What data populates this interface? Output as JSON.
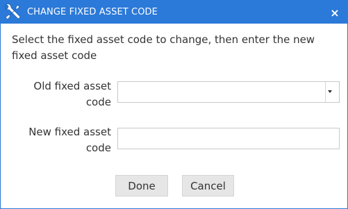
{
  "dialog": {
    "title": "CHANGE FIXED ASSET CODE",
    "title_icon": "tools-icon",
    "close_glyph": "×",
    "accent_color": "#2b79d8",
    "instruction": "Select the fixed asset code to change, then enter the new fixed asset code"
  },
  "form": {
    "old_code": {
      "label": "Old fixed asset code",
      "value": ""
    },
    "new_code": {
      "label": "New fixed asset code",
      "value": ""
    }
  },
  "buttons": {
    "done": "Done",
    "cancel": "Cancel"
  }
}
